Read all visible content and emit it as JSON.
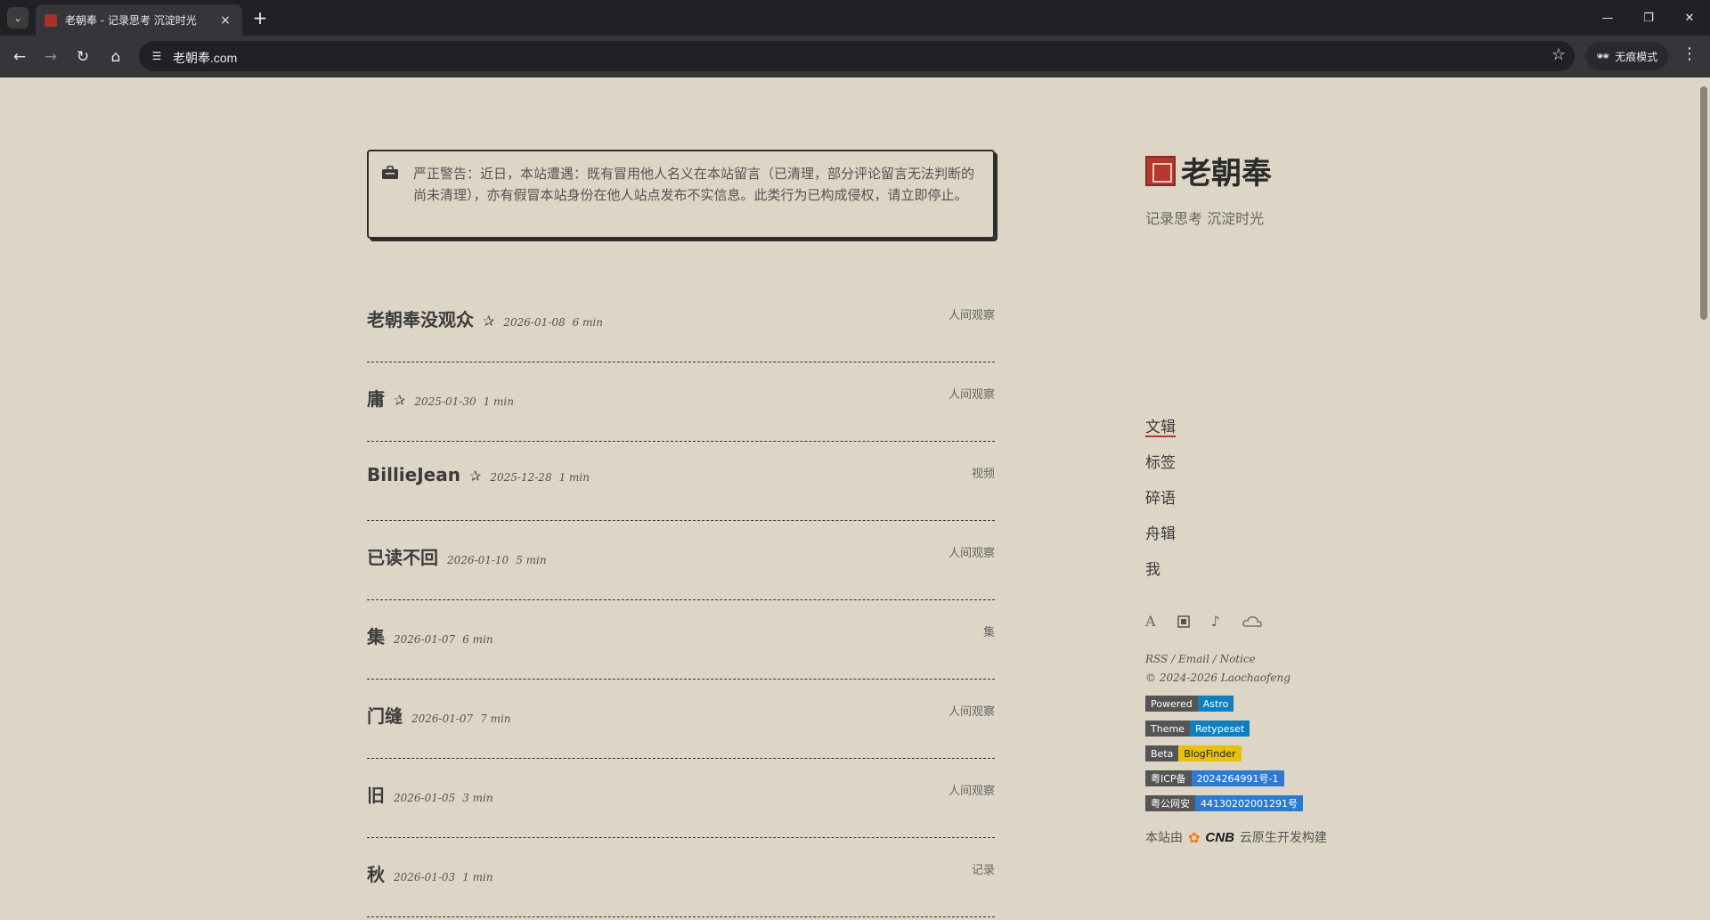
{
  "browser": {
    "tab_title": "老朝奉 - 记录思考 沉淀时光",
    "url": "老朝奉.com",
    "incognito_label": "无痕模式"
  },
  "notice": {
    "text": "严正警告：近日，本站遭遇：既有冒用他人名义在本站留言（已清理，部分评论留言无法判断的尚未清理），亦有假冒本站身份在他人站点发布不实信息。此类行为已构成侵权，请立即停止。"
  },
  "posts": [
    {
      "title": "老朝奉没观众",
      "pinned": true,
      "date": "2026-01-08",
      "read": "6 min",
      "category": "人间观察"
    },
    {
      "title": "庸",
      "pinned": true,
      "date": "2025-01-30",
      "read": "1 min",
      "category": "人间观察"
    },
    {
      "title": "BillieJean",
      "pinned": true,
      "date": "2025-12-28",
      "read": "1 min",
      "category": "视频"
    },
    {
      "title": "已读不回",
      "pinned": false,
      "date": "2026-01-10",
      "read": "5 min",
      "category": "人间观察"
    },
    {
      "title": "集",
      "pinned": false,
      "date": "2026-01-07",
      "read": "6 min",
      "category": "集"
    },
    {
      "title": "门缝",
      "pinned": false,
      "date": "2026-01-07",
      "read": "7 min",
      "category": "人间观察"
    },
    {
      "title": "旧",
      "pinned": false,
      "date": "2026-01-05",
      "read": "3 min",
      "category": "人间观察"
    },
    {
      "title": "秋",
      "pinned": false,
      "date": "2026-01-03",
      "read": "1 min",
      "category": "记录"
    }
  ],
  "sidebar": {
    "brand": "老朝奉",
    "tagline": "记录思考 沉淀时光",
    "nav": [
      "文辑",
      "标签",
      "碎语",
      "舟辑",
      "我"
    ],
    "icon_font_label": "A",
    "links": "RSS / Email / Notice",
    "copyright": "© 2024-2026 Laochaofeng",
    "badges": [
      {
        "label": "Powered",
        "value": "Astro"
      },
      {
        "label": "Theme",
        "value": "Retypeset"
      },
      {
        "label": "Beta",
        "value": "BlogFinder"
      },
      {
        "label": "粤ICP备",
        "value": "2024264991号-1"
      },
      {
        "label": "粤公网安",
        "value": "44130202001291号"
      }
    ],
    "built_prefix": "本站由",
    "built_brand": "CNB",
    "built_suffix": "云原生开发构建"
  },
  "colors": {
    "page_bg": "#ddd5c6",
    "accent": "#b4382e",
    "badge_blue": "#0e7fc0",
    "badge_yellow": "#e8c10c"
  }
}
